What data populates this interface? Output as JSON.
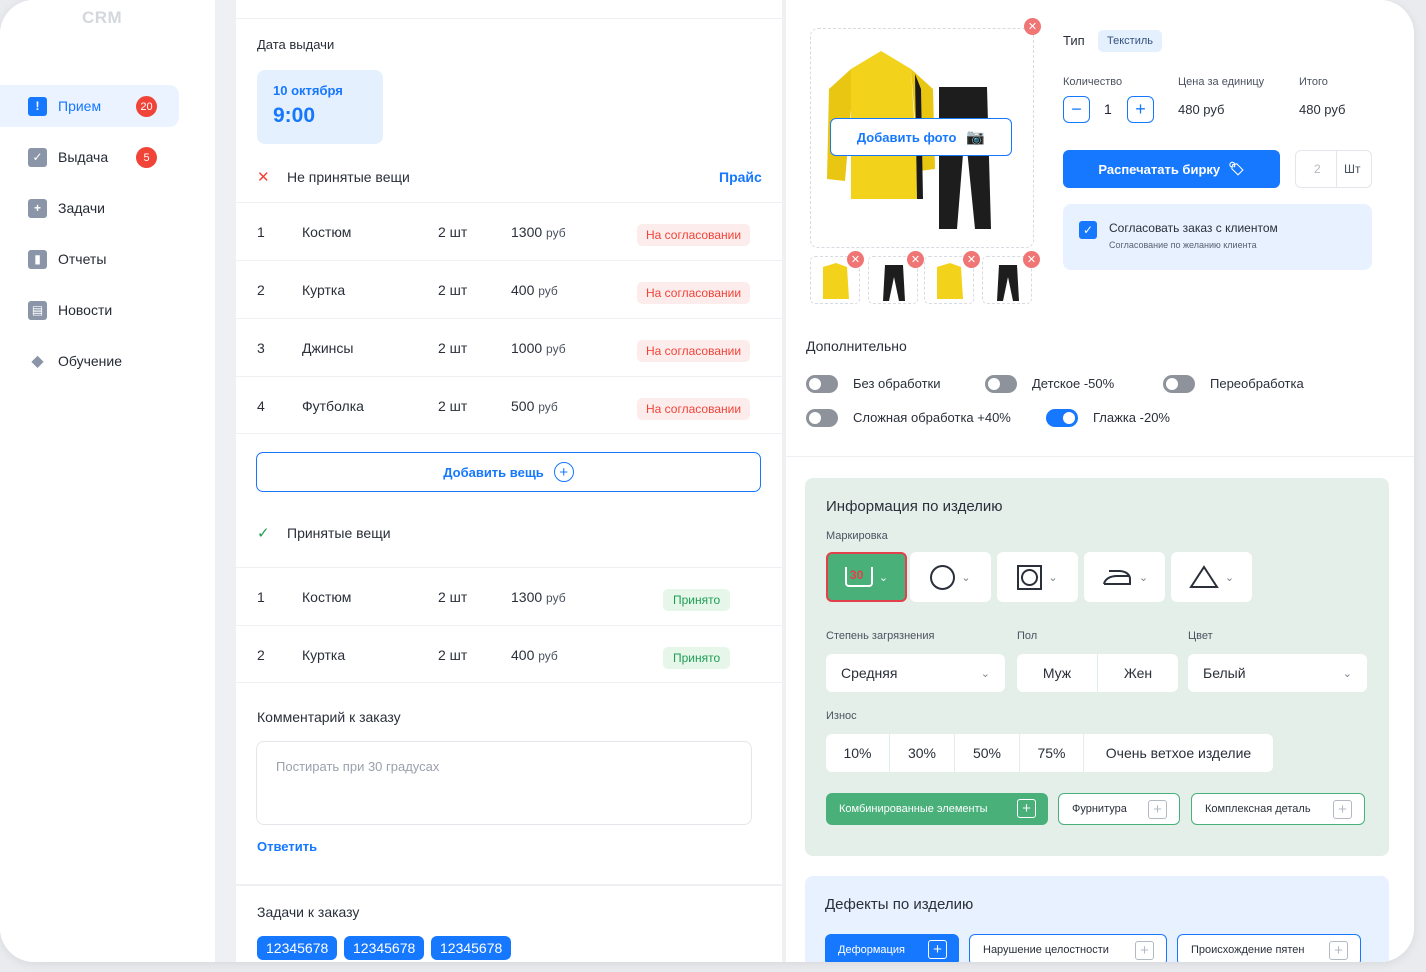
{
  "app": {
    "logo": "CRM"
  },
  "sidebar": {
    "items": [
      {
        "label": "Прием",
        "badge": "20",
        "active": true,
        "icon": "clipboard-alert-icon"
      },
      {
        "label": "Выдача",
        "badge": "5",
        "active": false,
        "icon": "clipboard-check-icon"
      },
      {
        "label": "Задачи",
        "badge": "",
        "active": false,
        "icon": "folder-plus-icon"
      },
      {
        "label": "Отчеты",
        "badge": "",
        "active": false,
        "icon": "bar-chart-icon"
      },
      {
        "label": "Новости",
        "badge": "",
        "active": false,
        "icon": "newspaper-icon"
      },
      {
        "label": "Обучение",
        "badge": "",
        "active": false,
        "icon": "graduation-cap-icon"
      }
    ]
  },
  "order": {
    "issue_date_label": "Дата выдачи",
    "issue_date": {
      "day": "10 октября",
      "time": "9:00"
    },
    "not_accepted_title": "Не принятые вещи",
    "price_link": "Прайс",
    "not_accepted": [
      {
        "num": "1",
        "name": "Костюм",
        "qty": "2 шт",
        "price": "1300",
        "unit": "руб",
        "status": "На согласовании"
      },
      {
        "num": "2",
        "name": "Куртка",
        "qty": "2 шт",
        "price": "400",
        "unit": "руб",
        "status": "На согласовании"
      },
      {
        "num": "3",
        "name": "Джинсы",
        "qty": "2 шт",
        "price": "1000",
        "unit": "руб",
        "status": "На согласовании"
      },
      {
        "num": "4",
        "name": "Футболка",
        "qty": "2 шт",
        "price": "500",
        "unit": "руб",
        "status": "На согласовании"
      }
    ],
    "add_item_button": "Добавить вещь",
    "accepted_title": "Принятые вещи",
    "accepted": [
      {
        "num": "1",
        "name": "Костюм",
        "qty": "2 шт",
        "price": "1300",
        "unit": "руб",
        "status": "Принято"
      },
      {
        "num": "2",
        "name": "Куртка",
        "qty": "2 шт",
        "price": "400",
        "unit": "руб",
        "status": "Принято"
      }
    ],
    "comment_title": "Комментарий к заказу",
    "comment_value": "Постирать при 30  градусах",
    "reply_link": "Ответить",
    "tasks_title": "Задачи к заказу",
    "tasks": [
      "12345678",
      "12345678",
      "12345678"
    ]
  },
  "item": {
    "add_photo_button": "Добавить фото",
    "type_label": "Тип",
    "type_value": "Текстиль",
    "qty_label": "Количество",
    "qty_value": "1",
    "unit_price_label": "Цена за единицу",
    "unit_price_value": "480 руб",
    "total_label": "Итого",
    "total_value": "480 руб",
    "print_button": "Распечатать бирку",
    "tag_count_placeholder": "2",
    "tag_count_unit": "Шт",
    "agree_title": "Согласовать заказ с клиентом",
    "agree_sub": "Согласование по желанию клиента",
    "extra_title": "Дополнительно",
    "toggles": [
      {
        "label": "Без обработки",
        "on": false
      },
      {
        "label": "Детское -50%",
        "on": false
      },
      {
        "label": "Переобработка",
        "on": false
      },
      {
        "label": "Сложная обработка +40%",
        "on": false
      },
      {
        "label": "Глажка -20%",
        "on": true
      }
    ]
  },
  "info": {
    "title": "Информация по изделию",
    "marking_label": "Маркировка",
    "wash_temp": "30",
    "dirt_label": "Степень загрязнения",
    "dirt_value": "Средняя",
    "gender_label": "Пол",
    "gender_options": [
      "Муж",
      "Жен"
    ],
    "color_label": "Цвет",
    "color_value": "Белый",
    "wear_label": "Износ",
    "wear_options": [
      "10%",
      "30%",
      "50%",
      "75%",
      "Очень ветхое изделие"
    ],
    "extras": [
      "Комбинированные элементы",
      "Фурнитура",
      "Комплексная деталь"
    ]
  },
  "defects": {
    "title": "Дефекты по изделию",
    "buttons": [
      "Деформация",
      "Нарушение целостности",
      "Происхождение пятен"
    ]
  },
  "colors": {
    "accent": "#1677ff",
    "danger": "#f04438",
    "success": "#1f9d55",
    "panel_green": "#e4efe9",
    "panel_blue": "#e7f1ff"
  }
}
